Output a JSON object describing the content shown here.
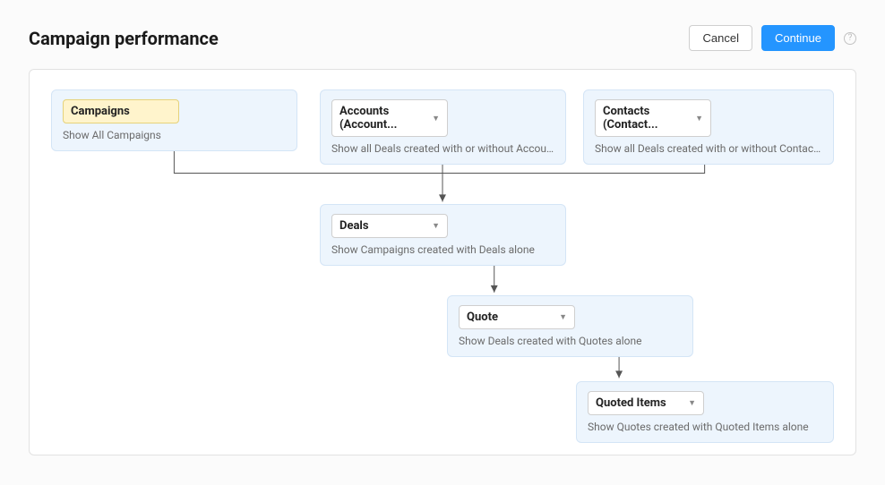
{
  "header": {
    "title": "Campaign performance",
    "cancel_label": "Cancel",
    "continue_label": "Continue",
    "help_symbol": "?"
  },
  "nodes": {
    "campaigns": {
      "label": "Campaigns",
      "desc": "Show All Campaigns"
    },
    "accounts": {
      "label": "Accounts (Account...",
      "desc": "Show all Deals created with or without Accounts (Ac..."
    },
    "contacts": {
      "label": "Contacts (Contact...",
      "desc": "Show all Deals created with or without Contacts (Co.."
    },
    "deals": {
      "label": "Deals",
      "desc": "Show Campaigns created with Deals alone"
    },
    "quote": {
      "label": "Quote",
      "desc": "Show Deals created with Quotes alone"
    },
    "quoted_items": {
      "label": "Quoted Items",
      "desc": "Show Quotes created with Quoted Items alone"
    }
  }
}
